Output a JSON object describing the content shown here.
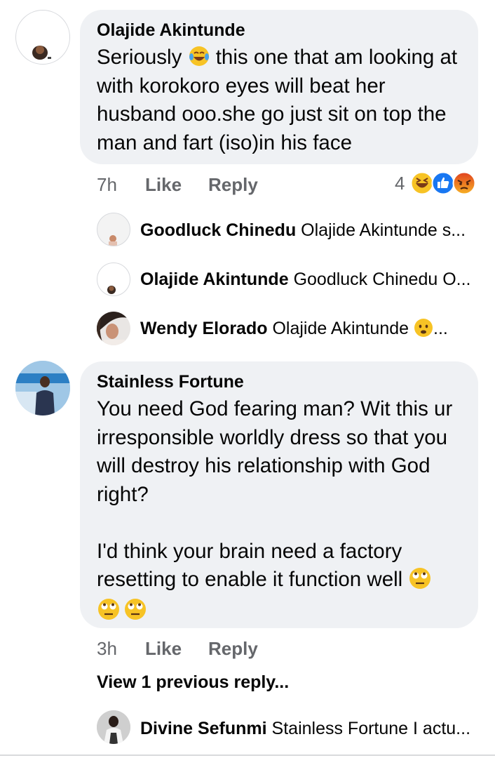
{
  "comments": [
    {
      "author": "Olajide Akintunde",
      "text": "Seriously",
      "text_after_emoji": " this one that am looking at with korokoro eyes will beat her husband ooo.she go just sit on top the man and fart (iso)in his face",
      "time": "7h",
      "like_label": "Like",
      "reply_label": "Reply",
      "reaction_count": "4",
      "reaction_icons": [
        "laughing-emoji",
        "like-reaction",
        "angry-reaction"
      ]
    },
    {
      "author": "Stainless Fortune",
      "text": "You need God fearing man? Wit this ur irresponsible worldly dress so that you will destroy his relationship with God right?\n\nI'd think your brain need a factory resetting to enable it function well",
      "time": "3h",
      "like_label": "Like",
      "reply_label": "Reply"
    }
  ],
  "replies_first": [
    {
      "author": "Goodluck Chinedu",
      "preview": "Olajide Akintunde s..."
    },
    {
      "author": "Olajide Akintunde",
      "preview": "Goodluck Chinedu O..."
    },
    {
      "author": "Wendy Elorado",
      "preview": "Olajide Akintunde",
      "preview_suffix": "..."
    }
  ],
  "view_previous": "View 1 previous reply...",
  "replies_second": [
    {
      "author": "Divine Sefunmi",
      "preview": "Stainless Fortune I actu..."
    }
  ],
  "colors": {
    "bubble": "#eff1f4",
    "meta": "#65676b",
    "like_blue": "#1877f2",
    "angry": "#e9710f"
  }
}
